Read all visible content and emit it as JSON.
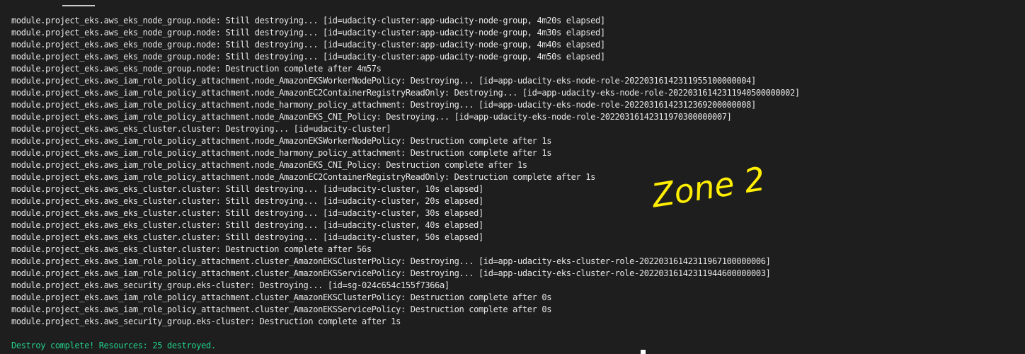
{
  "terminal": {
    "log_lines": [
      "module.project_eks.aws_eks_node_group.node: Still destroying... [id=udacity-cluster:app-udacity-node-group, 4m20s elapsed]",
      "module.project_eks.aws_eks_node_group.node: Still destroying... [id=udacity-cluster:app-udacity-node-group, 4m30s elapsed]",
      "module.project_eks.aws_eks_node_group.node: Still destroying... [id=udacity-cluster:app-udacity-node-group, 4m40s elapsed]",
      "module.project_eks.aws_eks_node_group.node: Still destroying... [id=udacity-cluster:app-udacity-node-group, 4m50s elapsed]",
      "module.project_eks.aws_eks_node_group.node: Destruction complete after 4m57s",
      "module.project_eks.aws_iam_role_policy_attachment.node_AmazonEKSWorkerNodePolicy: Destroying... [id=app-udacity-eks-node-role-20220316142311955100000004]",
      "module.project_eks.aws_iam_role_policy_attachment.node_AmazonEC2ContainerRegistryReadOnly: Destroying... [id=app-udacity-eks-node-role-20220316142311940500000002]",
      "module.project_eks.aws_iam_role_policy_attachment.node_harmony_policy_attachment: Destroying... [id=app-udacity-eks-node-role-20220316142312369200000008]",
      "module.project_eks.aws_iam_role_policy_attachment.node_AmazonEKS_CNI_Policy: Destroying... [id=app-udacity-eks-node-role-20220316142311970300000007]",
      "module.project_eks.aws_eks_cluster.cluster: Destroying... [id=udacity-cluster]",
      "module.project_eks.aws_iam_role_policy_attachment.node_AmazonEKSWorkerNodePolicy: Destruction complete after 1s",
      "module.project_eks.aws_iam_role_policy_attachment.node_harmony_policy_attachment: Destruction complete after 1s",
      "module.project_eks.aws_iam_role_policy_attachment.node_AmazonEKS_CNI_Policy: Destruction complete after 1s",
      "module.project_eks.aws_iam_role_policy_attachment.node_AmazonEC2ContainerRegistryReadOnly: Destruction complete after 1s",
      "module.project_eks.aws_eks_cluster.cluster: Still destroying... [id=udacity-cluster, 10s elapsed]",
      "module.project_eks.aws_eks_cluster.cluster: Still destroying... [id=udacity-cluster, 20s elapsed]",
      "module.project_eks.aws_eks_cluster.cluster: Still destroying... [id=udacity-cluster, 30s elapsed]",
      "module.project_eks.aws_eks_cluster.cluster: Still destroying... [id=udacity-cluster, 40s elapsed]",
      "module.project_eks.aws_eks_cluster.cluster: Still destroying... [id=udacity-cluster, 50s elapsed]",
      "module.project_eks.aws_eks_cluster.cluster: Destruction complete after 56s",
      "module.project_eks.aws_iam_role_policy_attachment.cluster_AmazonEKSClusterPolicy: Destroying... [id=app-udacity-eks-cluster-role-20220316142311967100000006]",
      "module.project_eks.aws_iam_role_policy_attachment.cluster_AmazonEKSServicePolicy: Destroying... [id=app-udacity-eks-cluster-role-20220316142311944600000003]",
      "module.project_eks.aws_security_group.eks-cluster: Destroying... [id=sg-024c654c155f7366a]",
      "module.project_eks.aws_iam_role_policy_attachment.cluster_AmazonEKSClusterPolicy: Destruction complete after 0s",
      "module.project_eks.aws_iam_role_policy_attachment.cluster_AmazonEKSServicePolicy: Destruction complete after 0s",
      "module.project_eks.aws_security_group.eks-cluster: Destruction complete after 1s"
    ],
    "summary_line": "Destroy complete! Resources: 25 destroyed."
  },
  "annotation": {
    "text": "Zone 2",
    "color": "#ffee00"
  },
  "colors": {
    "background": "#1e1e1e",
    "text": "#e6e6e6",
    "success": "#23d18b"
  }
}
